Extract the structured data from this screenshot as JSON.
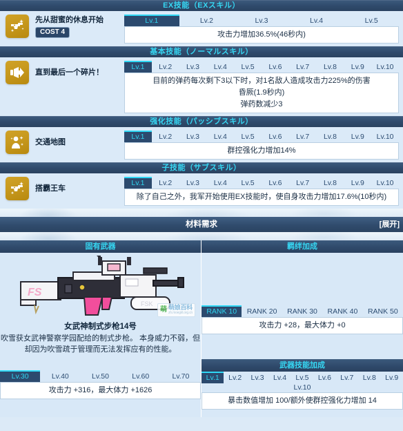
{
  "sections": {
    "ex": {
      "header": "EX技能（EXスキル）",
      "skill_name": "先从甜蜜的休息开始",
      "cost_label": "COST 4",
      "icon": "pistol-sparkle-icon",
      "levels": [
        "Lv.1",
        "Lv.2",
        "Lv.3",
        "Lv.4",
        "Lv.5"
      ],
      "active_level": "Lv.1",
      "description_lines": [
        "攻击力增加36.5%(46秒内)"
      ]
    },
    "normal": {
      "header": "基本技能（ノーマルスキル）",
      "skill_name": "直到最后一个碎片！",
      "icon": "megaphone-burst-icon",
      "levels": [
        "Lv.1",
        "Lv.2",
        "Lv.3",
        "Lv.4",
        "Lv.5",
        "Lv.6",
        "Lv.7",
        "Lv.8",
        "Lv.9",
        "Lv.10"
      ],
      "active_level": "Lv.1",
      "description_lines": [
        "目前的弹药每次剩下3以下时，对1名敌人造成攻击力225%的伤害",
        "昏厥(1.9秒内)",
        "弹药数减少3"
      ]
    },
    "passive": {
      "header": "强化技能（パッシブスキル）",
      "skill_name": "交通地图",
      "icon": "person-sparkle-icon",
      "levels": [
        "Lv.1",
        "Lv.2",
        "Lv.3",
        "Lv.4",
        "Lv.5",
        "Lv.6",
        "Lv.7",
        "Lv.8",
        "Lv.9",
        "Lv.10"
      ],
      "active_level": "Lv.1",
      "description_lines": [
        "群控强化力增加14%"
      ]
    },
    "sub": {
      "header": "子技能（サブスキル）",
      "skill_name": "搭霸王车",
      "icon": "pistol-sparkle-icon",
      "levels": [
        "Lv.1",
        "Lv.2",
        "Lv.3",
        "Lv.4",
        "Lv.5",
        "Lv.6",
        "Lv.7",
        "Lv.8",
        "Lv.9",
        "Lv.10"
      ],
      "active_level": "Lv.1",
      "description_lines": [
        "除了自己之外，我军开始使用EX技能时，使自身攻击力增加17.6%(10秒内)"
      ]
    }
  },
  "materials": {
    "title": "材料需求",
    "expand_label": "[展开]"
  },
  "weapon": {
    "header": "固有武器",
    "name": "女武神制式步枪14号",
    "description_lines": [
      "吹雪获女武神警察学园配给的制式步枪。",
      "本身威力不弱，但却因为吹雪疏于管理而无法发挥应有的性能。"
    ],
    "levels": [
      "Lv.30",
      "Lv.40",
      "Lv.50",
      "Lv.60",
      "Lv.70"
    ],
    "active_level": "Lv.30",
    "stat_text": "攻击力 +316，最大体力 +1626",
    "watermark": {
      "cn": "萌",
      "line1": "萌娘百科",
      "line2": "zh.moegirl.org.cn"
    }
  },
  "bond": {
    "header": "羁绊加成",
    "ranks": [
      "RANK 10",
      "RANK 20",
      "RANK 30",
      "RANK 40",
      "RANK 50"
    ],
    "active_rank": "RANK 10",
    "stat_text": "攻击力 +28，最大体力 +0"
  },
  "weapon_skill": {
    "header": "武器技能加成",
    "levels": [
      "Lv.1",
      "Lv.2",
      "Lv.3",
      "Lv.4",
      "Lv.5",
      "Lv.6",
      "Lv.7",
      "Lv.8",
      "Lv.9"
    ],
    "level_wrap": "Lv.10",
    "active_level": "Lv.1",
    "description": "暴击数值增加 100/额外使群控强化力增加 14"
  },
  "colors": {
    "header_bg": "#2f4a6b",
    "header_text": "#36d6f2",
    "tab_active_bg": "#2c4a6e",
    "tab_active_text": "#2fd4ef",
    "tab_active_top": "#2fd8f5",
    "page_bg": "#dceaf7",
    "icon_gold": "#c89a1f"
  }
}
